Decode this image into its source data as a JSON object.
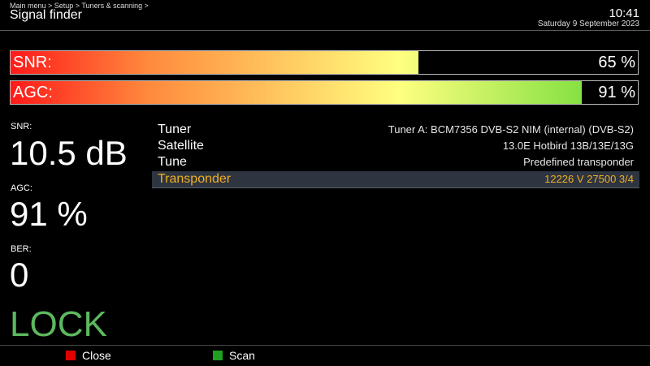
{
  "header": {
    "breadcrumb": "Main menu > Setup > Tuners & scanning >",
    "title": "Signal finder",
    "time": "10:41",
    "date": "Saturday  9 September 2023"
  },
  "bars": [
    {
      "label": "SNR:",
      "value_text": "65 %",
      "percent": 65
    },
    {
      "label": "AGC:",
      "value_text": "91 %",
      "percent": 91
    }
  ],
  "stats": {
    "snr": {
      "label": "SNR:",
      "value": "10.5 dB"
    },
    "agc": {
      "label": "AGC:",
      "value": "91 %"
    },
    "ber": {
      "label": "BER:",
      "value": "0"
    },
    "status": "LOCK"
  },
  "info": [
    {
      "key": "Tuner",
      "value": "Tuner A: BCM7356 DVB-S2 NIM (internal) (DVB-S2)"
    },
    {
      "key": "Satellite",
      "value": "13.0E Hotbird 13B/13E/13G"
    },
    {
      "key": "Tune",
      "value": "Predefined transponder"
    },
    {
      "key": "Transponder",
      "value": "12226 V 27500 3/4",
      "selected": true
    }
  ],
  "footer": {
    "red": {
      "label": "Close",
      "color": "#e00000"
    },
    "green": {
      "label": "Scan",
      "color": "#20a020"
    }
  },
  "colors": {
    "accent": "#f0b020",
    "lock": "#5db85d"
  }
}
